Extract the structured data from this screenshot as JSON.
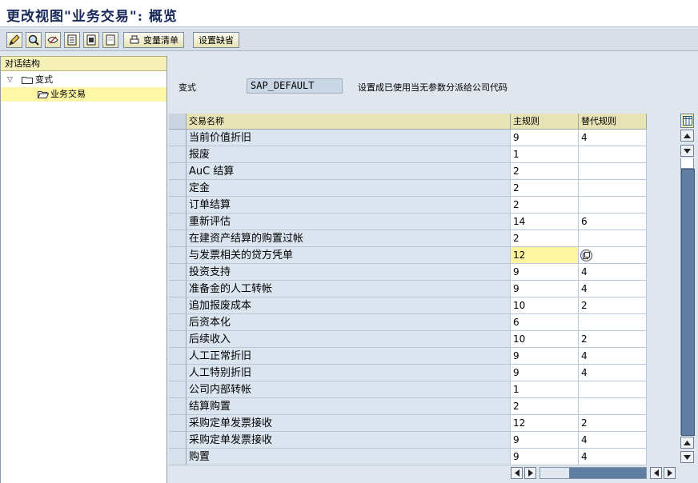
{
  "window": {
    "title": "更改视图\"业务交易\": 概览"
  },
  "toolbar": {
    "icons": [
      "edit-icon",
      "find-icon",
      "display-change-icon",
      "select-all-icon",
      "select-block-icon",
      "deselect-icon"
    ],
    "variable_list_label": "变量清单",
    "set_default_label": "设置缺省"
  },
  "sidebar": {
    "header": "对话结构",
    "items": [
      {
        "label": "变式",
        "level": 0,
        "expanded": true
      },
      {
        "label": "业务交易",
        "level": 1,
        "selected": true
      }
    ]
  },
  "variant": {
    "label": "变式",
    "value": "SAP_DEFAULT",
    "description": "设置成已使用当无参数分派给公司代码"
  },
  "table": {
    "columns": [
      "交易名称",
      "主规则",
      "替代规则"
    ],
    "rows": [
      {
        "name": "当前价值折旧",
        "main": "9",
        "alt": "4"
      },
      {
        "name": "报废",
        "main": "1",
        "alt": ""
      },
      {
        "name": "AuC 结算",
        "main": "2",
        "alt": ""
      },
      {
        "name": "定金",
        "main": "2",
        "alt": ""
      },
      {
        "name": "订单结算",
        "main": "2",
        "alt": ""
      },
      {
        "name": "重新评估",
        "main": "14",
        "alt": "6"
      },
      {
        "name": "在建资产结算的购置过帐",
        "main": "2",
        "alt": ""
      },
      {
        "name": "与发票相关的贷方凭单",
        "main": "12",
        "alt": ""
      },
      {
        "name": "投资支持",
        "main": "9",
        "alt": "4"
      },
      {
        "name": "准备金的人工转帐",
        "main": "9",
        "alt": "4"
      },
      {
        "name": "追加报废成本",
        "main": "10",
        "alt": "2"
      },
      {
        "name": "后资本化",
        "main": "6",
        "alt": ""
      },
      {
        "name": "后续收入",
        "main": "10",
        "alt": "2"
      },
      {
        "name": "人工正常折旧",
        "main": "9",
        "alt": "4"
      },
      {
        "name": "人工特别折旧",
        "main": "9",
        "alt": "4"
      },
      {
        "name": "公司内部转帐",
        "main": "1",
        "alt": ""
      },
      {
        "name": "结算购置",
        "main": "2",
        "alt": ""
      },
      {
        "name": "采购定单发票接收",
        "main": "12",
        "alt": "2"
      },
      {
        "name": "采购定单发票接收",
        "main": "9",
        "alt": "4"
      },
      {
        "name": "购置",
        "main": "9",
        "alt": "4"
      }
    ],
    "focused_row": 7,
    "focus_cell": "main"
  },
  "colors": {
    "title": "#1a2a5a",
    "header_yellow": "#e8e3b4",
    "focus": "#fff4a0",
    "scroll_thumb": "#5f7ea1"
  }
}
